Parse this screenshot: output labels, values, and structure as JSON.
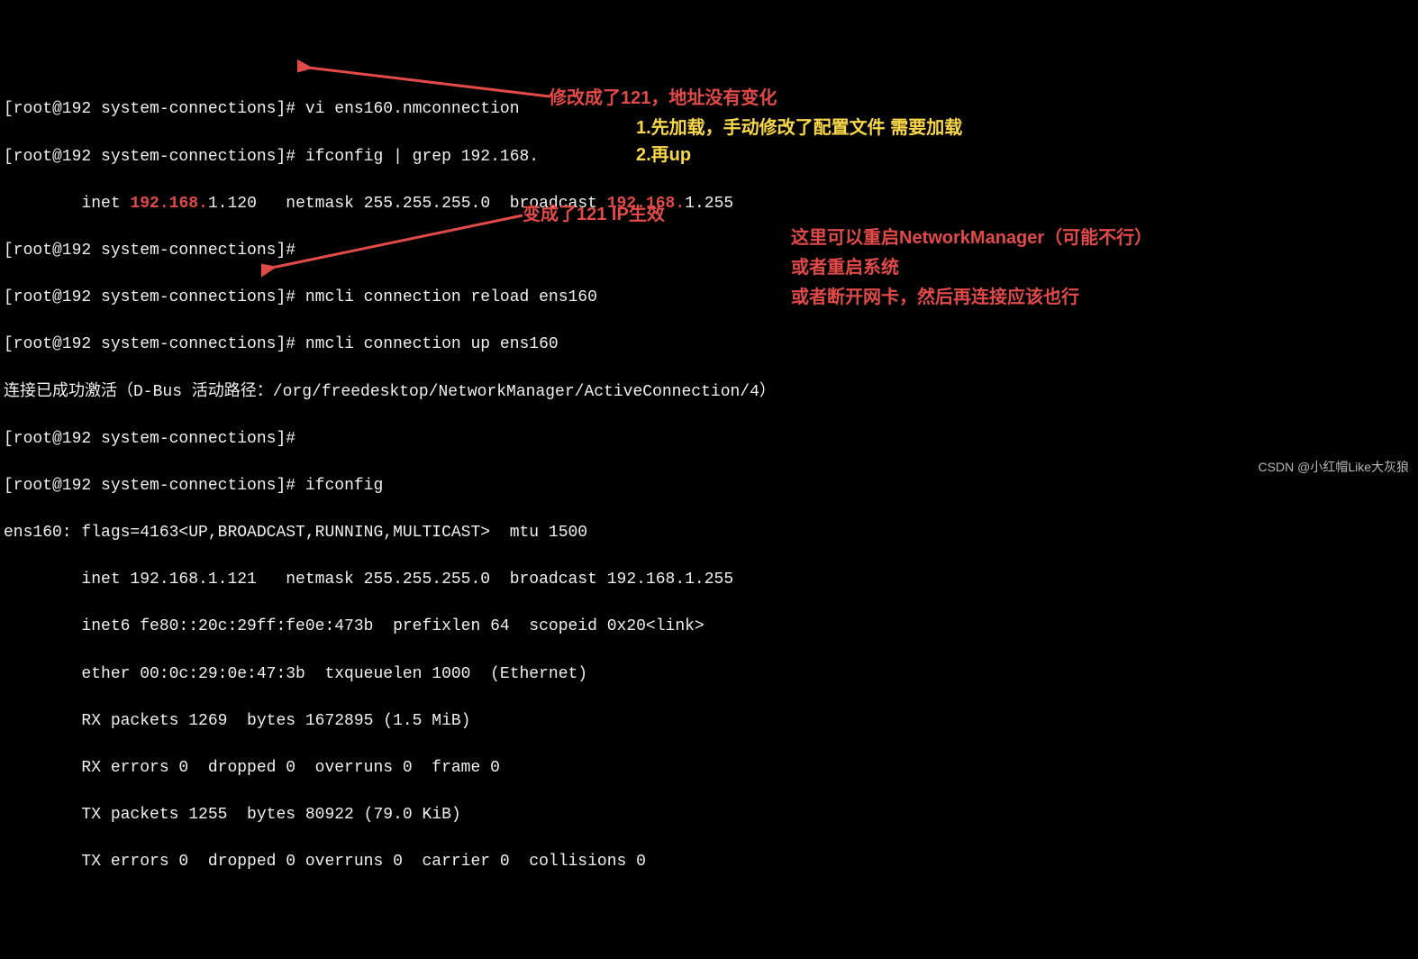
{
  "prompt": "[root@192 system-connections]# ",
  "lines": {
    "l1_cmd": "vi ens160.nmconnection",
    "l2_cmd": "ifconfig | grep 192.168.",
    "l3_pre": "        inet ",
    "l3_ip1": "192.168.",
    "l3_ip2": "1.120",
    "l3_mid": "   netmask 255.255.255.0  broadcast ",
    "l3_bc1": "192.168.",
    "l3_bc2": "1.255",
    "l4_cmd": "",
    "l5_cmd": "nmcli connection reload ens160",
    "l6_cmd": "nmcli connection up ens160",
    "l7": "连接已成功激活（D-Bus 活动路径：/org/freedesktop/NetworkManager/ActiveConnection/4）",
    "l8_cmd": "",
    "l9_cmd": "ifconfig",
    "l10": "ens160: flags=4163<UP,BROADCAST,RUNNING,MULTICAST>  mtu 1500",
    "l11": "        inet 192.168.1.121   netmask 255.255.255.0  broadcast 192.168.1.255",
    "l12": "        inet6 fe80::20c:29ff:fe0e:473b  prefixlen 64  scopeid 0x20<link>",
    "l13": "        ether 00:0c:29:0e:47:3b  txqueuelen 1000  (Ethernet)",
    "l14": "        RX packets 1269  bytes 1672895 (1.5 MiB)",
    "l15": "        RX errors 0  dropped 0  overruns 0  frame 0",
    "l16": "        TX packets 1255  bytes 80922 (79.0 KiB)",
    "l17": "        TX errors 0  dropped 0 overruns 0  carrier 0  collisions 0"
  },
  "annotations": {
    "a1": "修改成了121，地址没有变化",
    "a2": "1.先加载，手动修改了配置文件 需要加载",
    "a3": "2.再up",
    "a4": "变成了121 IP生效",
    "a5": "这里可以重启NetworkManager（可能不行）",
    "a6": "或者重启系统",
    "a7": "或者断开网卡，然后再连接应该也行"
  },
  "watermark": "CSDN @小红帽Like大灰狼"
}
